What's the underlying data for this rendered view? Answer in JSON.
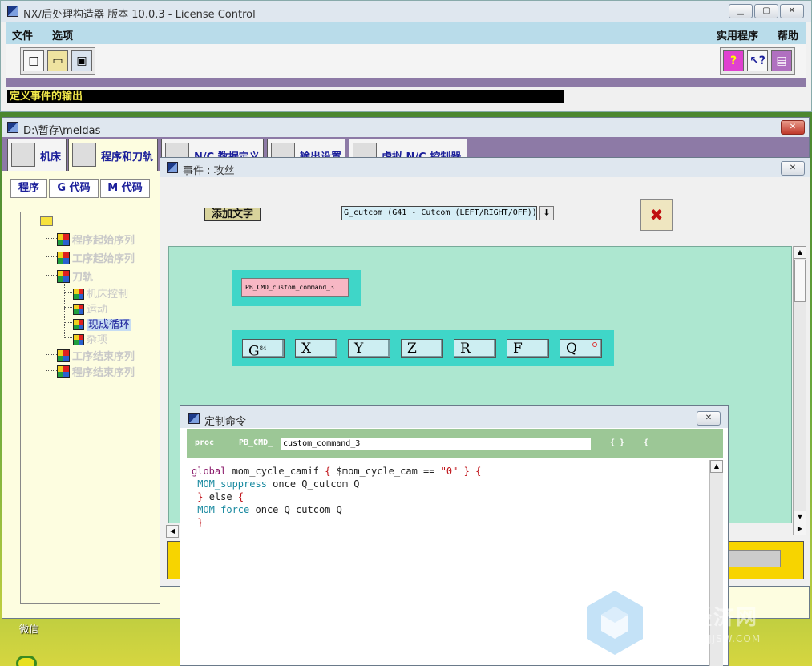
{
  "desktop": {
    "label": "微信"
  },
  "main_window": {
    "title": "NX/后处理构造器 版本 10.0.3 - License Control",
    "menus_left": [
      "文件",
      "选项"
    ],
    "menus_right": [
      "实用程序",
      "帮助"
    ],
    "status": "定义事件的输出"
  },
  "doc_window": {
    "title": "D:\\暂存\\meldas",
    "tabs": [
      "机床",
      "程序和刀轨",
      "N/C 数据定义",
      "输出设置",
      "虚拟 N/C 控制器"
    ],
    "subtabs": [
      "程序",
      "G 代码",
      "M 代码"
    ],
    "tree": {
      "program_start": "程序起始序列",
      "operation_start": "工序起始序列",
      "toolpath": "刀轨",
      "machine_control": "机床控制",
      "motion": "运动",
      "canned_cycle": "现成循环",
      "misc": "杂项",
      "operation_end": "工序结束序列",
      "program_end": "程序结束序列"
    }
  },
  "event_window": {
    "title": "事件 : 攻丝",
    "add_text_label": "添加文字",
    "combo_value": "G_cutcom (G41 - Cutcom (LEFT/RIGHT/OFF))",
    "custom_command_block": "PB_CMD_custom_command_3",
    "addresses": [
      {
        "label": "G",
        "sup": "84"
      },
      {
        "label": "X",
        "sup": ""
      },
      {
        "label": "Y",
        "sup": ""
      },
      {
        "label": "Z",
        "sup": ""
      },
      {
        "label": "R",
        "sup": ""
      },
      {
        "label": "F",
        "sup": ""
      },
      {
        "label": "Q",
        "sup": ""
      }
    ]
  },
  "custom_command_window": {
    "title": "定制命令",
    "proc_keyword": "proc",
    "proc_prefix": "PB_CMD_",
    "proc_name": "custom_command_3",
    "brace_open": "{ }",
    "brace_single": "{",
    "code_lines": [
      "global mom_cycle_camif { $mom_cycle_cam == \"0\" } {",
      " MOM_suppress once Q_cutcom Q",
      " } else {",
      " MOM_force once Q_cutcom Q",
      " }"
    ]
  },
  "watermark": {
    "text": "经济网",
    "sub": "JJSW.COM"
  },
  "colors": {
    "menubar": "#b9dcea",
    "purple": "#8d7aa6",
    "canvas": "#ade7d0",
    "block_border": "#3fd6c8",
    "tree_bg": "#fdfde0",
    "yellow_bar": "#f7d400"
  }
}
